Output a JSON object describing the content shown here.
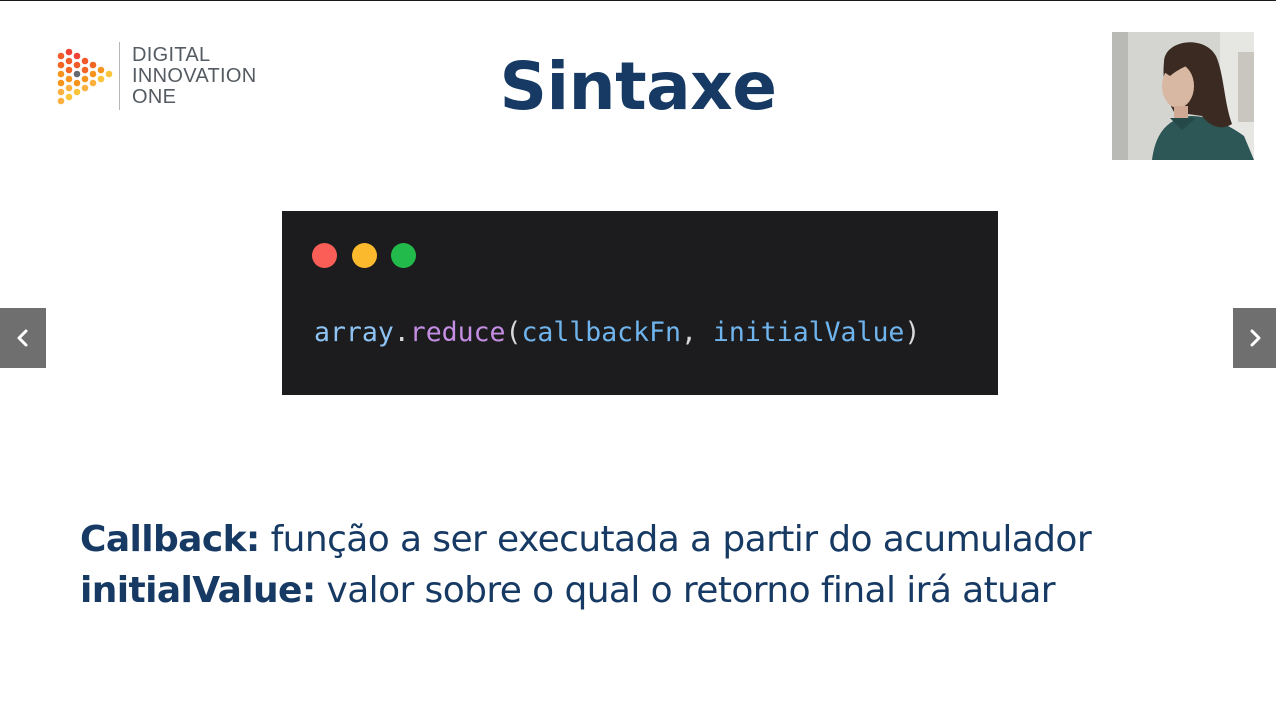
{
  "slide": {
    "title": "Sintaxe",
    "logo": {
      "lines": [
        "DIGITAL",
        "INNOVATION",
        "ONE"
      ]
    },
    "code": {
      "tokens": [
        {
          "text": "array",
          "kind": "ident"
        },
        {
          "text": ".",
          "kind": "punct"
        },
        {
          "text": "reduce",
          "kind": "method"
        },
        {
          "text": "(",
          "kind": "punct"
        },
        {
          "text": "callbackFn",
          "kind": "param"
        },
        {
          "text": ", ",
          "kind": "punct"
        },
        {
          "text": "initialValue",
          "kind": "param"
        },
        {
          "text": ")",
          "kind": "punct"
        }
      ],
      "window_dots": [
        "#fb5e57",
        "#fbba2d",
        "#22bb4b"
      ]
    },
    "definitions": [
      {
        "term": "Callback:",
        "description": " função a ser executada a partir do acumulador"
      },
      {
        "term": "initialValue:",
        "description": " valor sobre o qual o retorno final irá atuar"
      }
    ]
  },
  "navigation": {
    "prev_icon": "chevron-left-icon",
    "next_icon": "chevron-right-icon"
  },
  "colors": {
    "title": "#163a63",
    "code_background": "#1c1c1e",
    "nav_button": "#6f6f6f"
  }
}
